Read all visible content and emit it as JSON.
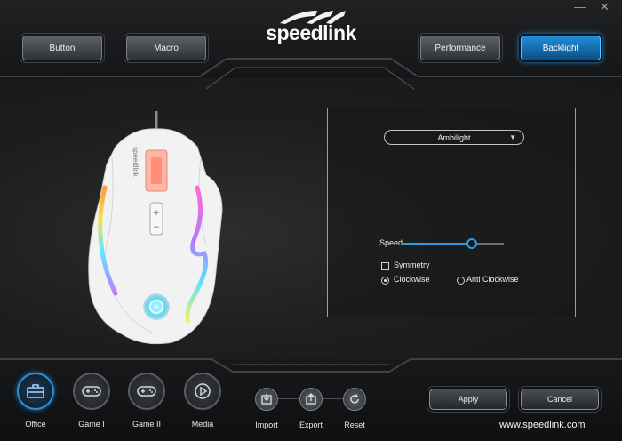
{
  "header": {
    "tabs": [
      {
        "label": "Button",
        "active": false
      },
      {
        "label": "Macro",
        "active": false
      },
      {
        "label": "Performance",
        "active": false
      },
      {
        "label": "Backlight",
        "active": true
      }
    ],
    "logo_text": "speedlink",
    "window_controls": {
      "minimize": "—",
      "close": "✕"
    }
  },
  "mouse": {
    "brand_text": "speedlink"
  },
  "backlight": {
    "effect_value": "Ambilight",
    "speed_label": "Speed",
    "speed_fraction": 0.68,
    "symmetry_label": "Symmetry",
    "symmetry_checked": false,
    "direction": {
      "clockwise_label": "Clockwise",
      "anticlockwise_label": "Anti Clockwise",
      "selected": "clockwise"
    }
  },
  "footer": {
    "profiles": [
      {
        "label": "Office",
        "icon": "toolbox-icon",
        "active": true
      },
      {
        "label": "Game I",
        "icon": "gamepad-icon",
        "active": false
      },
      {
        "label": "Game II",
        "icon": "gamepad-icon",
        "active": false
      },
      {
        "label": "Media",
        "icon": "play-icon",
        "active": false
      }
    ],
    "tools": [
      {
        "label": "Import",
        "icon": "import-icon"
      },
      {
        "label": "Export",
        "icon": "export-icon"
      },
      {
        "label": "Reset",
        "icon": "reset-icon"
      }
    ],
    "apply_label": "Apply",
    "cancel_label": "Cancel",
    "website": "www.speedlink.com"
  },
  "colors": {
    "accent": "#1786d1",
    "background": "#1a1a1b"
  }
}
